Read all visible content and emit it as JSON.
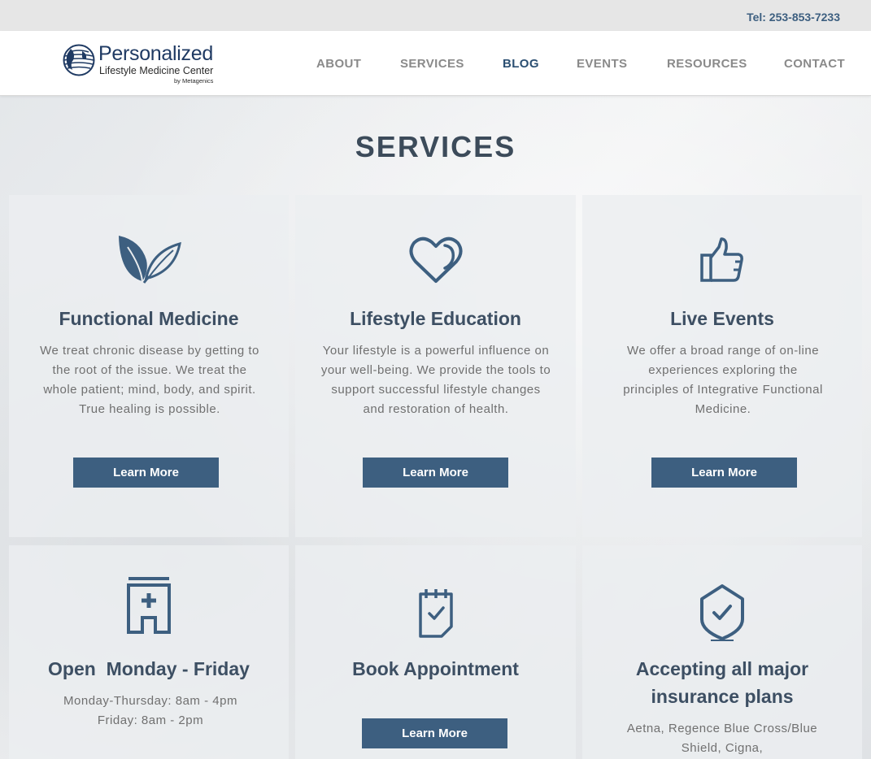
{
  "topbar": {
    "tel": "Tel: 253-853-7233"
  },
  "logo": {
    "line1": "Personalized",
    "line2": "Lifestyle Medicine Center",
    "line3": "by Metagenics"
  },
  "nav": {
    "items": [
      {
        "label": "ABOUT"
      },
      {
        "label": "SERVICES"
      },
      {
        "label": "BLOG"
      },
      {
        "label": "EVENTS"
      },
      {
        "label": "RESOURCES"
      },
      {
        "label": "CONTACT"
      }
    ],
    "active": "BLOG"
  },
  "section_title": "SERVICES",
  "cards": [
    {
      "icon": "leaf-icon",
      "title": "Functional Medicine",
      "text": "We treat chronic disease by getting to the root of the issue. We treat the whole patient; mind, body, and spirit. True healing is possible.",
      "button": "Learn More"
    },
    {
      "icon": "heart-icon",
      "title": "Lifestyle Education",
      "text": "Your lifestyle is a powerful influence on your well-being. We provide the tools to support successful lifestyle changes and restoration of health.",
      "button": "Learn More"
    },
    {
      "icon": "thumbs-up-icon",
      "title": "Live Events",
      "text": "We offer a broad range of on-line experiences exploring the principles of Integrative Functional Medicine.",
      "button": "Learn More"
    },
    {
      "icon": "hospital-icon",
      "title": "Open  Monday - Friday",
      "text": "Monday-Thursday: 8am - 4pm\nFriday: 8am - 2pm"
    },
    {
      "icon": "clipboard-check-icon",
      "title": "Book Appointment",
      "button": "Learn More"
    },
    {
      "icon": "shield-check-icon",
      "title": "Accepting all major insurance plans",
      "text": "Aetna, Regence Blue Cross/Blue Shield, Cigna,"
    }
  ],
  "colors": {
    "accent": "#3d5f80",
    "heading": "#3d4f63",
    "body_text": "#707070"
  }
}
